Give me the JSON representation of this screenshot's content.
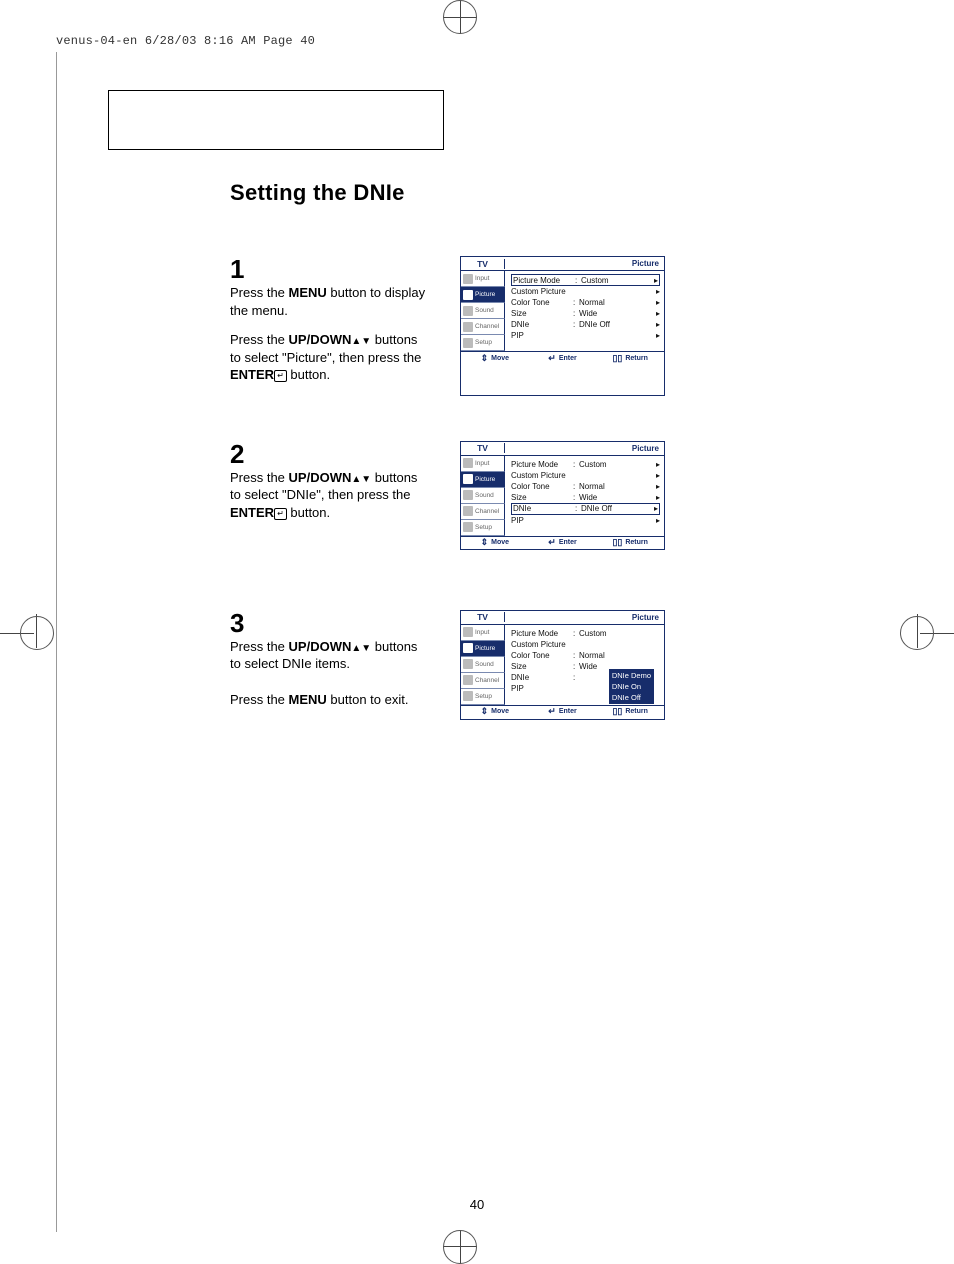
{
  "header_strip": "venus-04-en  6/28/03 8:16 AM  Page 40",
  "title": "Setting the DNIe",
  "page_number": "40",
  "arrows": "▲▼",
  "enter_glyph": "↵",
  "steps": {
    "s1": {
      "num": "1",
      "p1a": "Press the ",
      "p1b": "MENU",
      "p1c": " button to display the menu.",
      "p2a": "Press the ",
      "p2b": "UP/DOWN",
      "p2c": " buttons to select \"Picture\", then press the ",
      "p2d": "ENTER",
      "p2e": " button."
    },
    "s2": {
      "num": "2",
      "p1a": "Press the ",
      "p1b": "UP/DOWN",
      "p1c": " buttons to select \"DNIe\", then press the ",
      "p1d": "ENTER",
      "p1e": " button."
    },
    "s3": {
      "num": "3",
      "p1a": "Press the ",
      "p1b": "UP/DOWN",
      "p1c": " buttons to select DNIe items.",
      "p2a": "Press the ",
      "p2b": "MENU",
      "p2c": " button to exit."
    }
  },
  "osd": {
    "tv": "TV",
    "title": "Picture",
    "tabs": {
      "input": "Input",
      "picture": "Picture",
      "sound": "Sound",
      "channel": "Channel",
      "setup": "Setup"
    },
    "rows": {
      "pm_l": "Picture Mode",
      "pm_v": "Custom",
      "cp_l": "Custom Picture",
      "ct_l": "Color Tone",
      "ct_v": "Normal",
      "sz_l": "Size",
      "sz_v": "Wide",
      "dn_l": "DNIe",
      "dn_v": "DNIe Off",
      "pip_l": "PIP"
    },
    "dropdown": {
      "d1": "DNIe Demo",
      "d2": "DNIe On",
      "d3": "DNIe Off"
    },
    "foot": {
      "move": "Move",
      "enter": "Enter",
      "return": "Return"
    }
  }
}
